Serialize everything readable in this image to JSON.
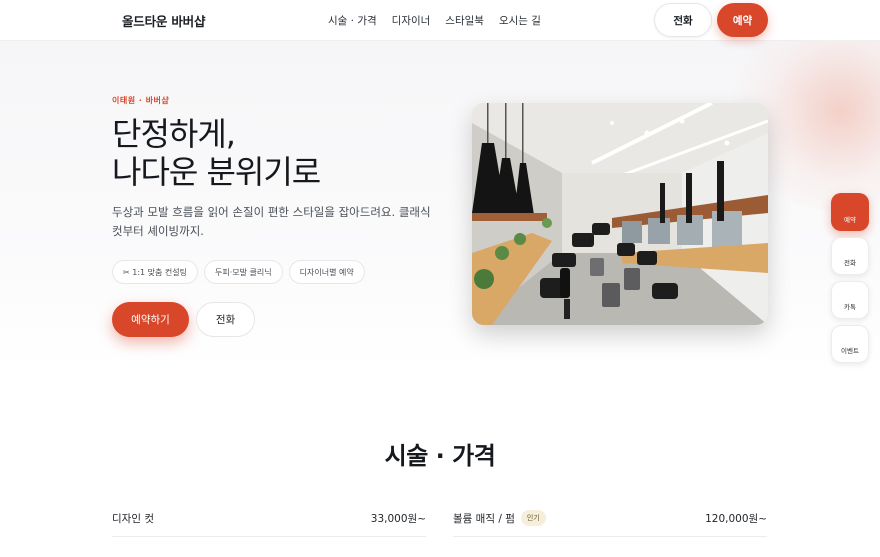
{
  "header": {
    "brand": "올드타운 바버샵",
    "nav": [
      "시술 · 가격",
      "디자이너",
      "스타일북",
      "오시는 길"
    ],
    "call_label": "전화",
    "book_label": "예약"
  },
  "hero": {
    "eyebrow": "이태원 · 바버샵",
    "headline_line1": "단정하게,",
    "headline_line2": "나다운 분위기로",
    "description": "두상과 모발 흐름을 읽어 손질이 편한 스타일을 잡아드려요. 클래식 컷부터 셰이빙까지.",
    "chips": [
      "✂ 1:1 맞춤 컨설팅",
      "두피·모발 클리닉",
      "디자이너별 예약"
    ],
    "book_button": "예약하기",
    "call_button": "전화"
  },
  "floating": [
    "예약",
    "전화",
    "카톡",
    "이벤트"
  ],
  "prices": {
    "title": "시술 · 가격",
    "left": [
      {
        "name": "디자인 컷",
        "price": "33,000원~",
        "badge": ""
      }
    ],
    "right": [
      {
        "name": "볼륨 매직 / 펌",
        "price": "120,000원~",
        "badge": "인기"
      }
    ]
  },
  "colors": {
    "accent": "#d9472b",
    "text": "#15191e",
    "muted": "#4a5058",
    "badge_bg": "#f5eedb"
  }
}
